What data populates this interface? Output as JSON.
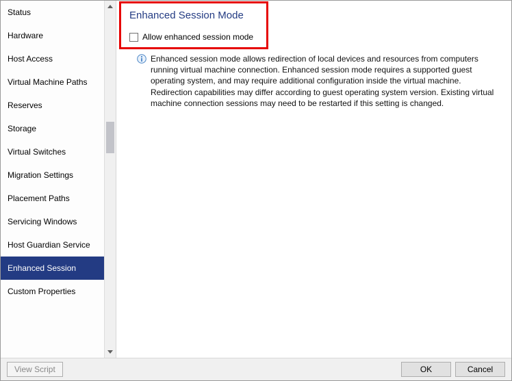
{
  "sidebar": {
    "items": [
      {
        "label": "Status"
      },
      {
        "label": "Hardware"
      },
      {
        "label": "Host Access"
      },
      {
        "label": "Virtual Machine Paths"
      },
      {
        "label": "Reserves"
      },
      {
        "label": "Storage"
      },
      {
        "label": "Virtual Switches"
      },
      {
        "label": "Migration Settings"
      },
      {
        "label": "Placement Paths"
      },
      {
        "label": "Servicing Windows"
      },
      {
        "label": "Host Guardian Service"
      },
      {
        "label": "Enhanced Session"
      },
      {
        "label": "Custom Properties"
      }
    ],
    "selected_index": 11
  },
  "content": {
    "title": "Enhanced Session Mode",
    "checkbox_label": "Allow enhanced session mode",
    "checkbox_checked": false,
    "info_text": "Enhanced session mode allows redirection of local devices and resources from computers running virtual machine connection. Enhanced session mode requires a supported guest operating system, and may require additional configuration inside the virtual machine. Redirection capabilities may differ according to guest operating system version. Existing virtual machine connection sessions may need to be restarted if this setting is changed."
  },
  "footer": {
    "view_script": "View Script",
    "ok": "OK",
    "cancel": "Cancel"
  }
}
